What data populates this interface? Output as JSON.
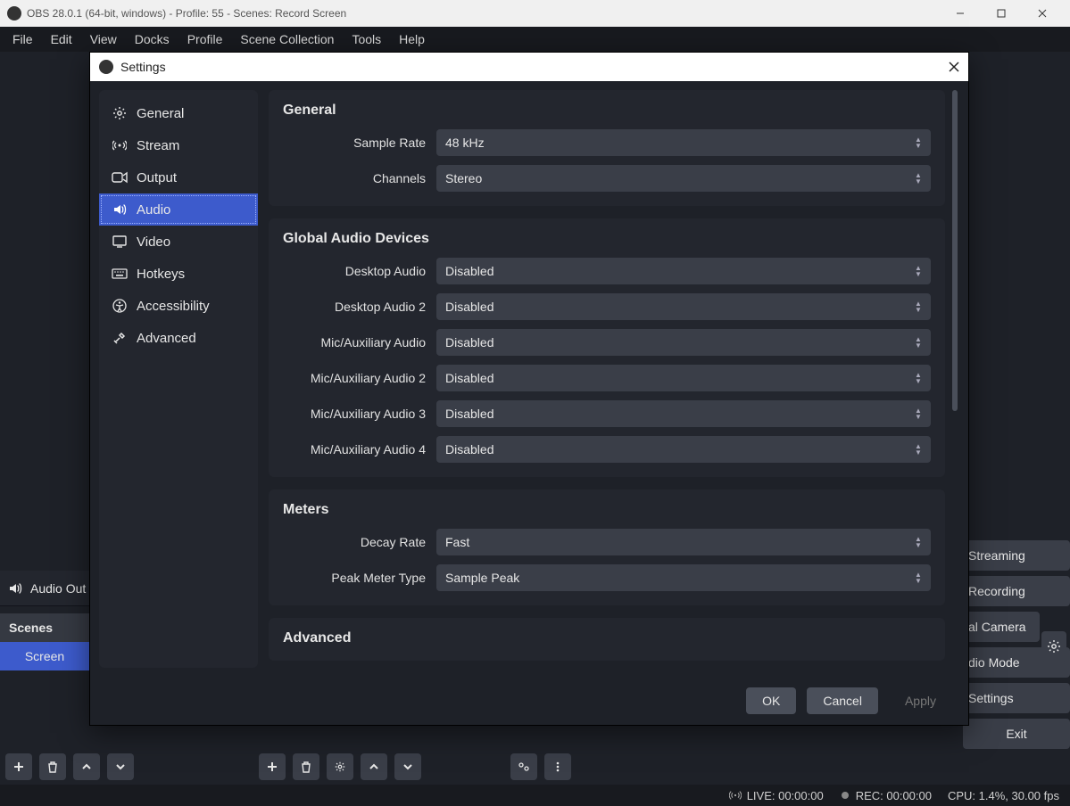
{
  "window": {
    "title": "OBS 28.0.1 (64-bit, windows) - Profile: 55 - Scenes: Record Screen"
  },
  "menubar": [
    "File",
    "Edit",
    "View",
    "Docks",
    "Profile",
    "Scene Collection",
    "Tools",
    "Help"
  ],
  "dialog": {
    "title": "Settings",
    "sidebar": [
      {
        "label": "General"
      },
      {
        "label": "Stream"
      },
      {
        "label": "Output"
      },
      {
        "label": "Audio"
      },
      {
        "label": "Video"
      },
      {
        "label": "Hotkeys"
      },
      {
        "label": "Accessibility"
      },
      {
        "label": "Advanced"
      }
    ],
    "sections": {
      "general": {
        "title": "General",
        "rows": [
          {
            "label": "Sample Rate",
            "value": "48 kHz"
          },
          {
            "label": "Channels",
            "value": "Stereo"
          }
        ]
      },
      "global": {
        "title": "Global Audio Devices",
        "rows": [
          {
            "label": "Desktop Audio",
            "value": "Disabled"
          },
          {
            "label": "Desktop Audio 2",
            "value": "Disabled"
          },
          {
            "label": "Mic/Auxiliary Audio",
            "value": "Disabled"
          },
          {
            "label": "Mic/Auxiliary Audio 2",
            "value": "Disabled"
          },
          {
            "label": "Mic/Auxiliary Audio 3",
            "value": "Disabled"
          },
          {
            "label": "Mic/Auxiliary Audio 4",
            "value": "Disabled"
          }
        ]
      },
      "meters": {
        "title": "Meters",
        "rows": [
          {
            "label": "Decay Rate",
            "value": "Fast"
          },
          {
            "label": "Peak Meter Type",
            "value": "Sample Peak"
          }
        ]
      },
      "advanced": {
        "title": "Advanced"
      }
    },
    "buttons": {
      "ok": "OK",
      "cancel": "Cancel",
      "apply": "Apply"
    }
  },
  "panels": {
    "audio_out": "Audio Out",
    "scenes_header": "Scenes",
    "scene": "Screen"
  },
  "right_buttons": [
    "Streaming",
    "Recording",
    "al Camera",
    "dio Mode",
    "Settings",
    "Exit"
  ],
  "status": {
    "live": "LIVE: 00:00:00",
    "rec": "REC: 00:00:00",
    "cpu": "CPU: 1.4%, 30.00 fps"
  }
}
